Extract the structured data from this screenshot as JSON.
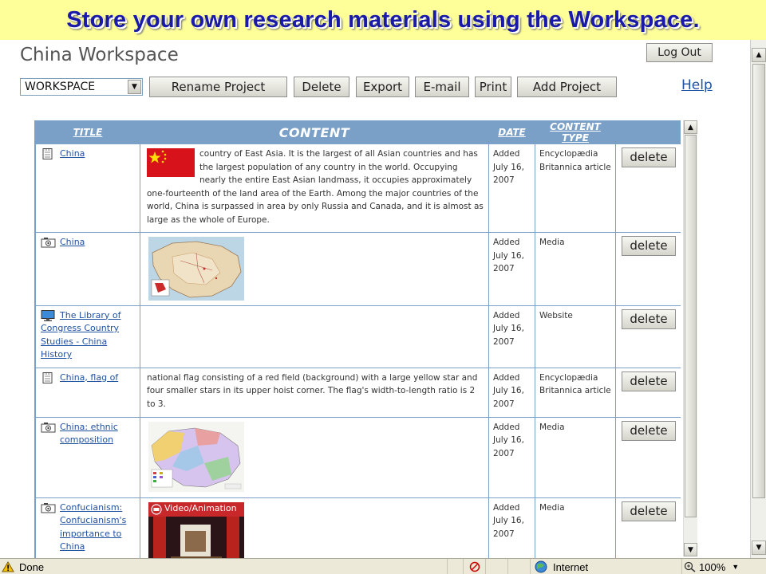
{
  "banner": {
    "title": "Store your own research materials using the Workspace."
  },
  "app": {
    "page_title": "China Workspace",
    "logout_label": "Log Out",
    "help_label": "Help",
    "workspace_select": {
      "value": "WORKSPACE"
    },
    "toolbar": {
      "rename": "Rename Project",
      "delete": "Delete",
      "export": "Export",
      "email": "E-mail",
      "print": "Print",
      "add_project": "Add Project"
    }
  },
  "grid": {
    "headers": {
      "title": "TITLE",
      "content": "CONTENT",
      "date": "DATE",
      "type": "CONTENT TYPE"
    },
    "rows": [
      {
        "icon": "article-icon",
        "title": "China",
        "thumb": "china-flag-thumbnail",
        "content": "country of East Asia. It is the largest of all Asian countries and has the largest population of any country in the world. Occupying nearly the entire East Asian landmass, it occupies approximately one-fourteenth of the land area of the Earth. Among the major countries of the world, China is surpassed in area by only Russia and Canada, and it is almost as large as the whole of Europe.",
        "date": "Added July 16, 2007",
        "type": "Encyclopædia Britannica article",
        "action": "delete"
      },
      {
        "icon": "camera-icon",
        "title": "China",
        "thumb": "china-map-thumbnail",
        "content": "",
        "date": "Added July 16, 2007",
        "type": "Media",
        "action": "delete"
      },
      {
        "icon": "monitor-icon",
        "title": "The Library of Congress Country Studies - China History",
        "thumb": "",
        "content": "",
        "date": "Added July 16, 2007",
        "type": "Website",
        "action": "delete"
      },
      {
        "icon": "article-icon",
        "title": "China, flag of",
        "thumb": "",
        "content": "national flag consisting of a red field (background) with a large yellow star and four smaller stars in its upper hoist corner. The flag's width-to-length ratio is 2 to 3.",
        "date": "Added July 16, 2007",
        "type": "Encyclopædia Britannica article",
        "action": "delete"
      },
      {
        "icon": "camera-icon",
        "title": "China: ethnic composition",
        "thumb": "ethnic-map-thumbnail",
        "content": "",
        "date": "Added July 16, 2007",
        "type": "Media",
        "action": "delete"
      },
      {
        "icon": "camera-icon",
        "title": "Confucianism: Confucianism's importance to China",
        "thumb": "video-thumbnail",
        "thumb_label": "Video/Animation",
        "content": "",
        "date": "Added July 16, 2007",
        "type": "Media",
        "action": "delete"
      }
    ]
  },
  "statusbar": {
    "done": "Done",
    "zone": "Internet",
    "zoom": "100%"
  },
  "colors": {
    "banner_bg": "#ffff99",
    "banner_text": "#1a1aa8",
    "rule": "#8b1a1a",
    "grid_header": "#7aa0c8",
    "link": "#2050a0"
  }
}
